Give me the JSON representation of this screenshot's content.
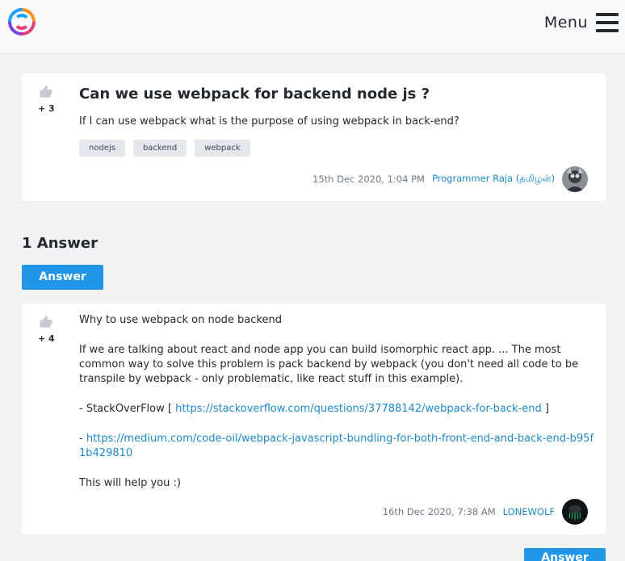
{
  "header": {
    "menu_label": "Menu",
    "logo_icon": "colorful-swirl-logo",
    "menu_icon": "hamburger-icon"
  },
  "question": {
    "score": "+ 3",
    "title": "Can we use webpack for backend node js ?",
    "body": "If I can use webpack what is the purpose of using webpack in back-end?",
    "tags": [
      "nodejs",
      "backend",
      "webpack"
    ],
    "date": "15th Dec 2020, 1:04 PM",
    "user": "Programmer Raja (தமிழன்)"
  },
  "answers_heading": "1 Answer",
  "answer_button_label": "Answer",
  "answer": {
    "score": "+ 4",
    "intro": "Why to use webpack on node backend",
    "paragraph": "If we are talking about react and node app you can build isomorphic react app. ... The most common way to solve this problem is pack backend by webpack (you don't need all code to be transpile by webpack - only problematic, like react stuff in this example).",
    "ref1_prefix": "- StackOverFlow [ ",
    "ref1_link": "https://stackoverflow.com/questions/37788142/webpack-for-back-end",
    "ref1_suffix": " ]",
    "ref2_prefix": "- ",
    "ref2_link": "https://medium.com/code-oil/webpack-javascript-bundling-for-both-front-end-and-back-end-b95f1b429810",
    "closing": "This will help you :)",
    "date": "16th Dec 2020, 7:38 AM",
    "user": "LONEWOLF"
  },
  "colors": {
    "accent": "#2196e8",
    "link": "#1e88c7",
    "background": "#f1f2f4"
  }
}
